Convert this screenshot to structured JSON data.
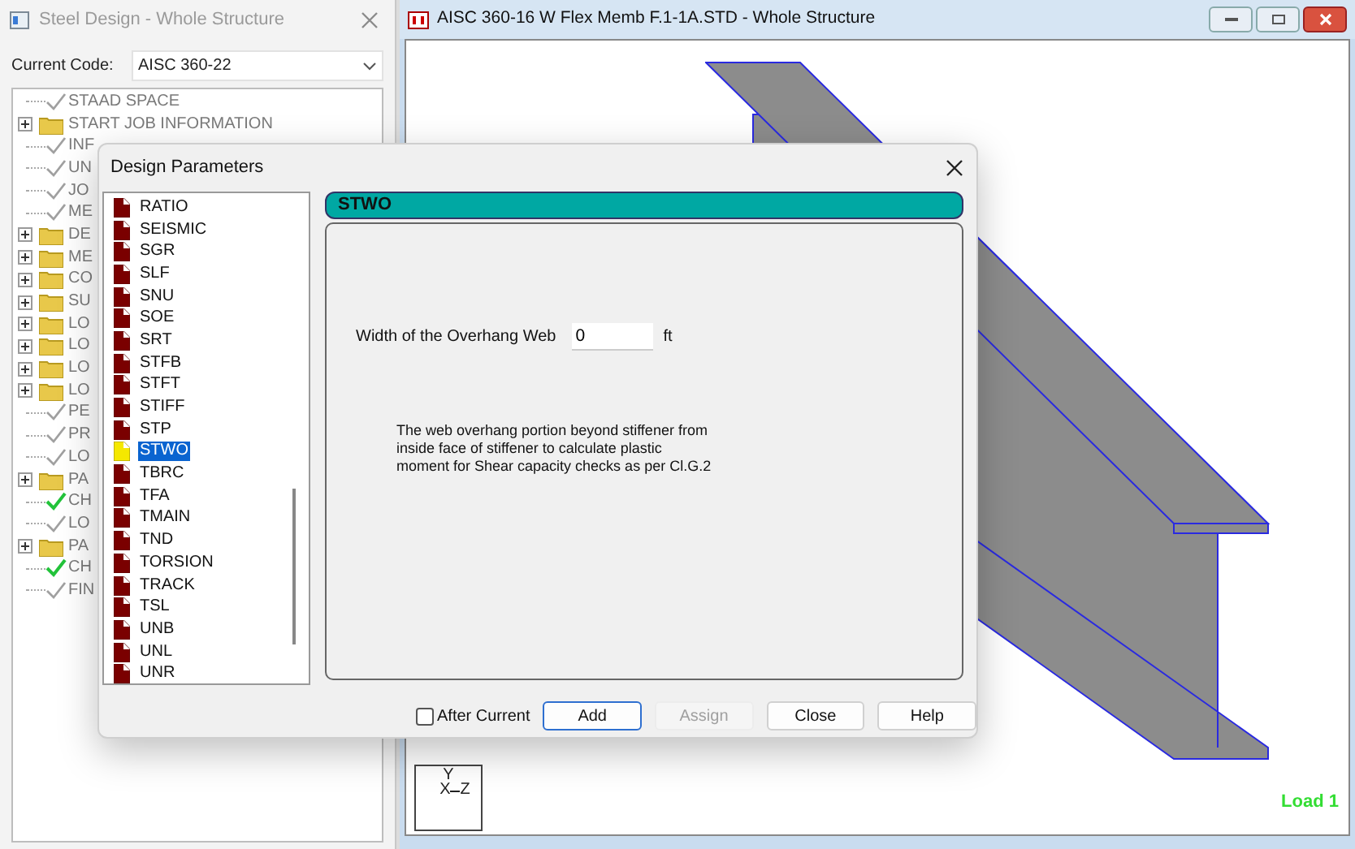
{
  "left_window": {
    "title": "Steel Design - Whole Structure",
    "code_label": "Current Code:",
    "code_value": "AISC 360-22",
    "tree": [
      {
        "label": "STAAD SPACE",
        "kind": "check",
        "done": false
      },
      {
        "label": "START JOB INFORMATION",
        "kind": "folder",
        "expanded": false
      },
      {
        "label": "INF",
        "kind": "check",
        "done": false
      },
      {
        "label": "UN",
        "kind": "check",
        "done": false
      },
      {
        "label": "JO",
        "kind": "check",
        "done": false
      },
      {
        "label": "ME",
        "kind": "check",
        "done": false
      },
      {
        "label": "DE",
        "kind": "folder",
        "expanded": false
      },
      {
        "label": "ME",
        "kind": "folder",
        "expanded": false
      },
      {
        "label": "CO",
        "kind": "folder",
        "expanded": false
      },
      {
        "label": "SU",
        "kind": "folder",
        "expanded": false
      },
      {
        "label": "LO",
        "kind": "folder",
        "expanded": false
      },
      {
        "label": "LO",
        "kind": "folder",
        "expanded": false
      },
      {
        "label": "LO",
        "kind": "folder",
        "expanded": false
      },
      {
        "label": "LO",
        "kind": "folder",
        "expanded": false
      },
      {
        "label": "PE",
        "kind": "check",
        "done": false
      },
      {
        "label": "PR",
        "kind": "check",
        "done": false
      },
      {
        "label": "LO",
        "kind": "check",
        "done": false
      },
      {
        "label": "PA",
        "kind": "folder",
        "expanded": false
      },
      {
        "label": "CH",
        "kind": "check",
        "done": true
      },
      {
        "label": "LO",
        "kind": "check",
        "done": false
      },
      {
        "label": "PA",
        "kind": "folder",
        "expanded": false
      },
      {
        "label": "CH",
        "kind": "check",
        "done": true
      },
      {
        "label": "FIN",
        "kind": "check",
        "done": false
      }
    ]
  },
  "viewport": {
    "title": "AISC 360-16 W Flex Memb F.1-1A.STD - Whole Structure",
    "axis": {
      "y": "Y",
      "x": "X",
      "z": "Z"
    },
    "load_label": "Load 1"
  },
  "dialog": {
    "title": "Design Parameters",
    "parameters": [
      {
        "label": "RATIO",
        "selected": false
      },
      {
        "label": "SEISMIC",
        "selected": false
      },
      {
        "label": "SGR",
        "selected": false
      },
      {
        "label": "SLF",
        "selected": false
      },
      {
        "label": "SNU",
        "selected": false
      },
      {
        "label": "SOE",
        "selected": false
      },
      {
        "label": "SRT",
        "selected": false
      },
      {
        "label": "STFB",
        "selected": false
      },
      {
        "label": "STFT",
        "selected": false
      },
      {
        "label": "STIFF",
        "selected": false
      },
      {
        "label": "STP",
        "selected": false
      },
      {
        "label": "STWO",
        "selected": true
      },
      {
        "label": "TBRC",
        "selected": false
      },
      {
        "label": "TFA",
        "selected": false
      },
      {
        "label": "TMAIN",
        "selected": false
      },
      {
        "label": "TND",
        "selected": false
      },
      {
        "label": "TORSION",
        "selected": false
      },
      {
        "label": "TRACK",
        "selected": false
      },
      {
        "label": "TSL",
        "selected": false
      },
      {
        "label": "UNB",
        "selected": false
      },
      {
        "label": "UNL",
        "selected": false
      },
      {
        "label": "UNR",
        "selected": false
      }
    ],
    "header": "STWO",
    "field": {
      "label": "Width of the Overhang Web",
      "value": "0",
      "unit": "ft"
    },
    "description": "The web overhang portion beyond stiffener from inside face of stiffener to calculate plastic moment for Shear capacity checks as per Cl.G.2",
    "after_current": {
      "label": "After Current",
      "checked": false
    },
    "buttons": [
      {
        "label": "Add",
        "default": true,
        "disabled": false
      },
      {
        "label": "Assign",
        "default": false,
        "disabled": true
      },
      {
        "label": "Close",
        "default": false,
        "disabled": false
      },
      {
        "label": "Help",
        "default": false,
        "disabled": false
      }
    ]
  }
}
